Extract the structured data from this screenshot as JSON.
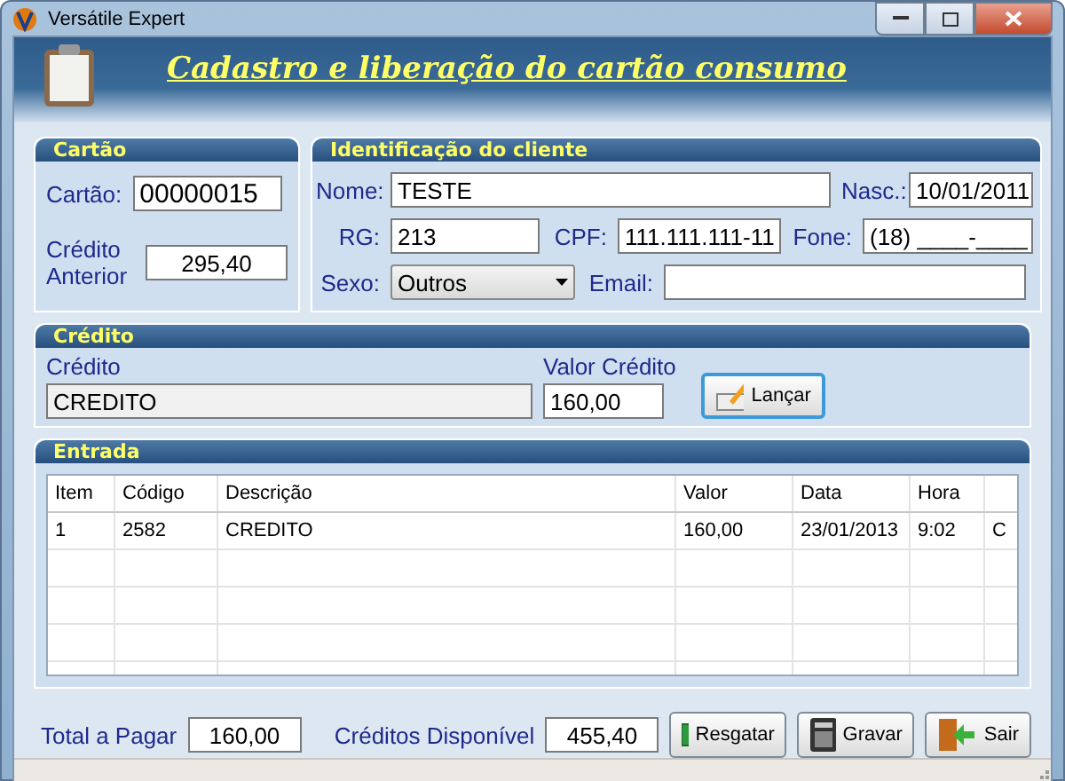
{
  "window": {
    "title": "Versátile Expert"
  },
  "header": {
    "title": "Cadastro e liberação do cartão consumo"
  },
  "cartao": {
    "title": "Cartão",
    "cartao_label": "Cartão:",
    "cartao_value": "00000015",
    "credito_label": "Crédito Anterior",
    "credito_value": "295,40"
  },
  "cliente": {
    "title": "Identificação do cliente",
    "nome_label": "Nome:",
    "nome": "TESTE",
    "nasc_label": "Nasc.:",
    "nasc": "10/01/2011",
    "rg_label": "RG:",
    "rg": "213",
    "cpf_label": "CPF:",
    "cpf": "111.111.111-11",
    "fone_label": "Fone:",
    "fone": "(18) ____-____",
    "sexo_label": "Sexo:",
    "sexo": "Outros",
    "email_label": "Email:"
  },
  "credito": {
    "title": "Crédito",
    "credito_label": "Crédito",
    "credito_value": "CREDITO",
    "valor_label": "Valor Crédito",
    "valor": "160,00",
    "button": "Lançar"
  },
  "entrada": {
    "title": "Entrada",
    "columns": [
      "Item",
      "Código",
      "Descrição",
      "Valor",
      "Data",
      "Hora"
    ],
    "rows": [
      [
        "1",
        "2582",
        "CREDITO",
        "160,00",
        "23/01/2013",
        "9:02",
        "C"
      ]
    ]
  },
  "footer": {
    "total_label": "Total a Pagar",
    "total": "160,00",
    "disp_label": "Créditos Disponível",
    "disp": "455,40",
    "buttons": [
      {
        "kind": "money",
        "label": "Resgatar"
      },
      {
        "kind": "calc",
        "label": "Gravar"
      },
      {
        "kind": "exit",
        "label": "Sair"
      }
    ]
  }
}
